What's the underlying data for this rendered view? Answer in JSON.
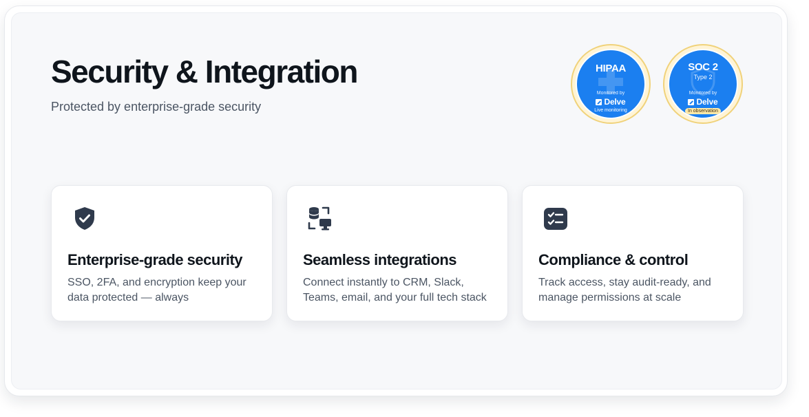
{
  "header": {
    "title": "Security & Integration",
    "subtitle": "Protected by enterprise-grade security"
  },
  "badges": [
    {
      "main": "HIPAA",
      "type": "",
      "monitored": "Monitored by",
      "brand": "Delve",
      "status": "Live monitoring",
      "icon": "medical-cross-icon"
    },
    {
      "main": "SOC 2",
      "type": "Type 2",
      "monitored": "Monitored by",
      "brand": "Delve",
      "status": "In observation",
      "icon": "shield-icon"
    }
  ],
  "features": [
    {
      "icon": "shield-check-icon",
      "title": "Enterprise-grade security",
      "desc": "SSO, 2FA, and encryption keep your data protected — always"
    },
    {
      "icon": "database-sync-icon",
      "title": "Seamless integrations",
      "desc": "Connect instantly to CRM, Slack, Teams, email, and your full tech stack"
    },
    {
      "icon": "checklist-icon",
      "title": "Compliance & control",
      "desc": "Track access, stay audit-ready, and manage permissions at scale"
    }
  ],
  "colors": {
    "badge_blue": "#1b7ff0",
    "badge_ring": "#f0d27a",
    "icon_dark": "#2f3a4c",
    "title": "#0f151c",
    "body": "#4b5563"
  }
}
